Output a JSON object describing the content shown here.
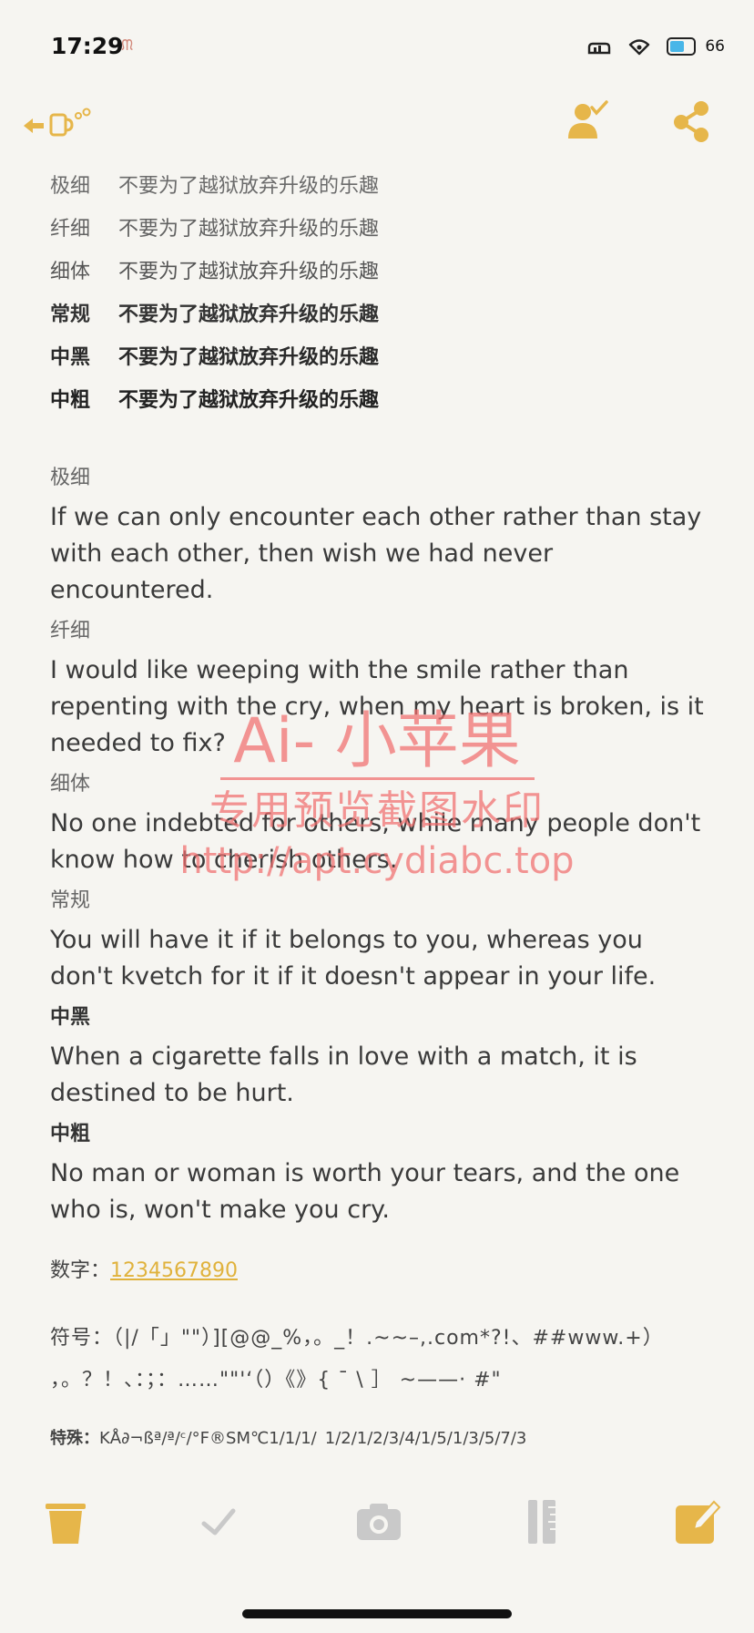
{
  "status": {
    "time": "17:29",
    "battery": "66",
    "battery_fraction": 0.66,
    "colors": {
      "battery_fill": "#48b6e8",
      "accent": "#e0b23c"
    }
  },
  "toolbar": {
    "back_icon": "back-arrow-mug-icon",
    "contact_icon": "contact-check-icon",
    "share_icon": "share-icon"
  },
  "weights": [
    {
      "label": "极细",
      "text": "不要为了越狱放弃升级的乐趣"
    },
    {
      "label": "纤细",
      "text": "不要为了越狱放弃升级的乐趣"
    },
    {
      "label": "细体",
      "text": "不要为了越狱放弃升级的乐趣"
    },
    {
      "label": "常规",
      "text": "不要为了越狱放弃升级的乐趣"
    },
    {
      "label": "中黑",
      "text": "不要为了越狱放弃升级的乐趣"
    },
    {
      "label": "中粗",
      "text": "不要为了越狱放弃升级的乐趣"
    }
  ],
  "sections": [
    {
      "label": "极细",
      "text": "If we can only encounter each other rather than stay with each other, then wish we had never encountered."
    },
    {
      "label": "纤细",
      "text": "I would like weeping with the smile rather than repenting with the cry, when my heart is broken, is it needed to fix?"
    },
    {
      "label": "细体",
      "text": "No one indebted for others, while many people don't know how to cherish others."
    },
    {
      "label": "常规",
      "text": "You will have it if it belongs to you, whereas you don't kvetch for it if it doesn't appear in your life."
    },
    {
      "label": "中黑",
      "text": "When a cigarette falls in love with a match, it is destined to be hurt."
    },
    {
      "label": "中粗",
      "text": "No man or woman is worth your tears, and the one who is, won't make you cry."
    }
  ],
  "digits": {
    "label": "数字：",
    "value": "1234567890"
  },
  "symbols": {
    "label": "符号：",
    "line1": "（|/「」\"\"）][@@_%，。_！.~~–,.com*?!、##www.+）",
    "line2": "，。？！、：；：……\"\"'‘（）《》{ ˉ \\ ］ ~——· #\""
  },
  "special": {
    "label": "特殊：",
    "value": "KÅ∂¬ßª/ª/ᶜ/°F®SM℃1/1/1/_1/2/1/2/3/4/1/5/1/3/5/7/3"
  },
  "watermark": {
    "line1": "Ai- 小苹果",
    "line2": "专用预览截图水印",
    "line3": "http://apt.cydiabc.top"
  },
  "bottom_toolbar": [
    "trash-icon",
    "checkmark-icon",
    "camera-icon",
    "ruler-icon",
    "compose-icon"
  ]
}
